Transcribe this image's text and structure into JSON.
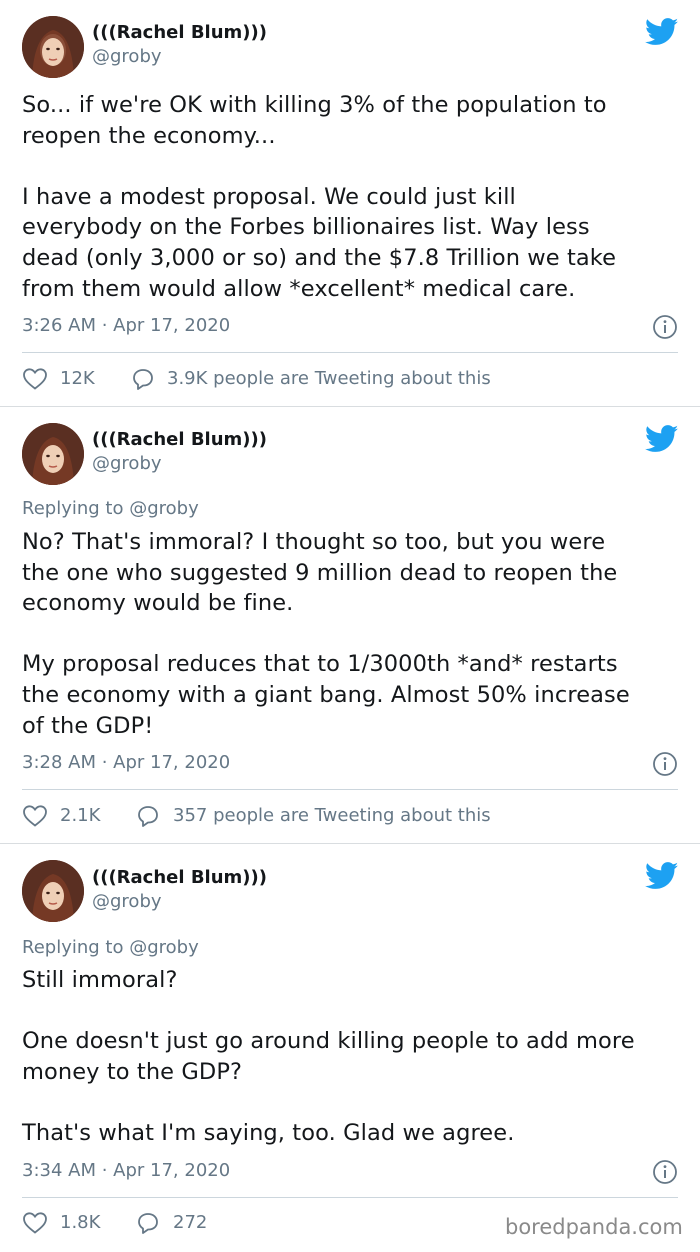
{
  "tweets": [
    {
      "display_name": "(((Rachel Blum)))",
      "handle": "@groby",
      "replying_to": "",
      "lines": [
        "So... if we're OK with killing 3% of the population to",
        "reopen the economy...",
        "",
        "I have a modest proposal. We could just kill",
        "everybody on the Forbes billionaires list. Way less",
        "dead (only 3,000 or so) and the $7.8 Trillion we take",
        "from them would allow *excellent* medical care."
      ],
      "timestamp": "3:26 AM · Apr 17, 2020",
      "likes": "12K",
      "conversation": "3.9K people are Tweeting about this"
    },
    {
      "display_name": "(((Rachel Blum)))",
      "handle": "@groby",
      "replying_to": "Replying to @groby",
      "lines": [
        "No? That's immoral? I thought so too, but you were",
        "the one who suggested 9 million dead to reopen the",
        "economy would be fine.",
        "",
        "My proposal reduces that to 1/3000th *and* restarts",
        "the economy with a giant bang. Almost 50% increase",
        "of the GDP!"
      ],
      "timestamp": "3:28 AM · Apr 17, 2020",
      "likes": "2.1K",
      "conversation": "357 people are Tweeting about this"
    },
    {
      "display_name": "(((Rachel Blum)))",
      "handle": "@groby",
      "replying_to": "Replying to @groby",
      "lines": [
        "Still immoral?",
        "",
        "One doesn't just go around killing people to add more",
        "money to the GDP?",
        "",
        "That's what I'm saying, too. Glad we agree."
      ],
      "timestamp": "3:34 AM · Apr 17, 2020",
      "likes": "1.8K",
      "conversation": "272"
    }
  ],
  "icons": {
    "brand": "twitter-bird-icon",
    "info": "info-icon",
    "like": "heart-icon",
    "reply": "speech-bubble-icon"
  },
  "colors": {
    "twitter_blue": "#1da1f2",
    "text_primary": "#14171a",
    "text_secondary": "#657786",
    "divider": "#ccd6dd"
  },
  "watermark": "boredpanda.com"
}
